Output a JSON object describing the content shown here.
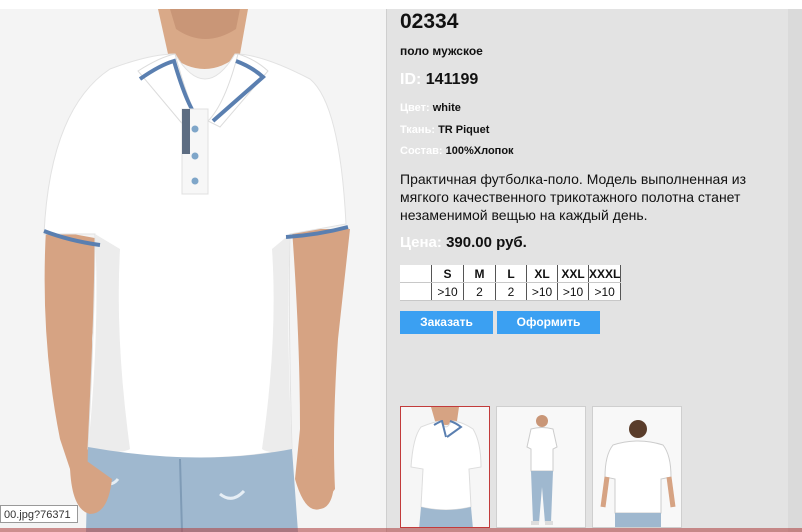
{
  "product": {
    "sku": "02334",
    "subtitle": "поло мужское",
    "id_label": "ID:",
    "id_value": "141199",
    "color_label": "Цвет:",
    "color_value": "white",
    "fabric_label": "Ткань:",
    "fabric_value": "TR Piquet",
    "composition_label": "Состав:",
    "composition_value": "100%Хлопок",
    "description": "Практичная футболка-поло. Модель выполненная из мягкого качественного трикотажного полотна станет незаменимой вещью на каждый день.",
    "price_label": "Цена:",
    "price_value": "390.00 руб."
  },
  "sizes": {
    "headers": [
      "",
      "S",
      "M",
      "L",
      "XL",
      "XXL",
      "XXXL"
    ],
    "stock": [
      "",
      ">10",
      "2",
      "2",
      ">10",
      ">10",
      ">10"
    ]
  },
  "buttons": {
    "order": "Заказать",
    "checkout": "Оформить"
  },
  "thumbnails": [
    {
      "name": "front-closeup",
      "selected": true
    },
    {
      "name": "full-body-front",
      "selected": false
    },
    {
      "name": "back-view",
      "selected": false
    }
  ],
  "tooltip": "00.jpg?76371",
  "colors": {
    "panel_bg": "#e3e3e3",
    "button": "#3ba0f2",
    "selected_thumb_border": "#c23b3b",
    "collar_trim": "#5a7fb0"
  }
}
